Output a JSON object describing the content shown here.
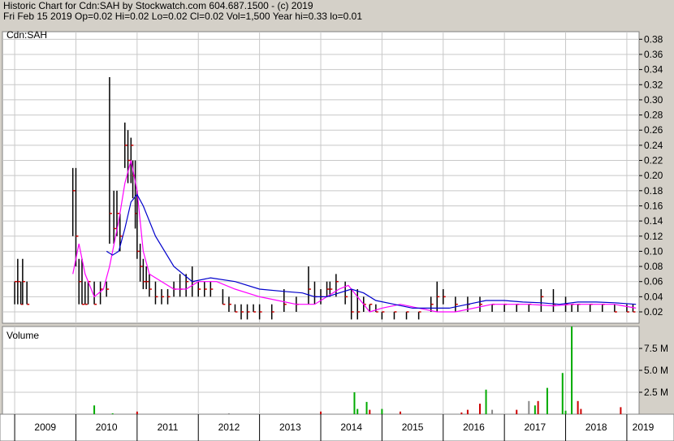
{
  "header": {
    "title": "Historic Chart for Cdn:SAH by Stockwatch.com 604.687.1500 - (c) 2019",
    "quote": "Fri Feb 15 2019   Op=0.02  Hi=0.02  Lo=0.02  Cl=0.02  Vol=1,500  Year hi=0.33  lo=0.01"
  },
  "chart_data": [
    {
      "type": "line",
      "title": "Cdn:SAH",
      "xlabel": "",
      "ylabel": "",
      "ylim": [
        0.005,
        0.39
      ],
      "grid": true,
      "legend": "none",
      "yticks": [
        "0.02",
        "0.04",
        "0.06",
        "0.08",
        "0.10",
        "0.12",
        "0.14",
        "0.16",
        "0.18",
        "0.20",
        "0.22",
        "0.24",
        "0.26",
        "0.28",
        "0.30",
        "0.32",
        "0.34",
        "0.36",
        "0.38"
      ],
      "xticks": [
        "2009",
        "2010",
        "2011",
        "2012",
        "2013",
        "2014",
        "2015",
        "2016",
        "2017",
        "2018",
        "2019"
      ],
      "series": [
        {
          "kind": "price-bars",
          "color": "#000000",
          "close_color": "#cc0000",
          "x": [
            2009.0,
            2009.05,
            2009.1,
            2009.13,
            2009.2,
            2009.95,
            2010.0,
            2010.05,
            2010.1,
            2010.15,
            2010.2,
            2010.3,
            2010.4,
            2010.5,
            2010.55,
            2010.62,
            2010.67,
            2010.72,
            2010.8,
            2010.85,
            2010.9,
            2010.93,
            2010.97,
            2011.0,
            2011.05,
            2011.1,
            2011.15,
            2011.2,
            2011.3,
            2011.4,
            2011.5,
            2011.6,
            2011.7,
            2011.8,
            2011.9,
            2012.0,
            2012.1,
            2012.2,
            2012.4,
            2012.5,
            2012.6,
            2012.7,
            2012.8,
            2012.9,
            2013.0,
            2013.2,
            2013.4,
            2013.6,
            2013.8,
            2013.9,
            2014.0,
            2014.1,
            2014.15,
            2014.25,
            2014.4,
            2014.5,
            2014.6,
            2014.7,
            2014.8,
            2014.9,
            2015.0,
            2015.2,
            2015.4,
            2015.6,
            2015.8,
            2015.9,
            2016.0,
            2016.2,
            2016.4,
            2016.6,
            2016.8,
            2017.0,
            2017.2,
            2017.4,
            2017.6,
            2017.8,
            2018.0,
            2018.1,
            2018.2,
            2018.4,
            2018.6,
            2018.8,
            2019.0,
            2019.1
          ],
          "high": [
            0.06,
            0.09,
            0.06,
            0.09,
            0.06,
            0.21,
            0.21,
            0.09,
            0.09,
            0.06,
            0.06,
            0.06,
            0.06,
            0.06,
            0.33,
            0.18,
            0.18,
            0.15,
            0.27,
            0.26,
            0.25,
            0.22,
            0.22,
            0.18,
            0.11,
            0.09,
            0.08,
            0.07,
            0.06,
            0.05,
            0.05,
            0.06,
            0.07,
            0.07,
            0.08,
            0.06,
            0.06,
            0.06,
            0.05,
            0.04,
            0.03,
            0.03,
            0.03,
            0.03,
            0.03,
            0.03,
            0.05,
            0.04,
            0.08,
            0.06,
            0.05,
            0.06,
            0.06,
            0.07,
            0.06,
            0.05,
            0.05,
            0.04,
            0.03,
            0.03,
            0.02,
            0.02,
            0.02,
            0.02,
            0.04,
            0.06,
            0.05,
            0.04,
            0.04,
            0.04,
            0.03,
            0.03,
            0.03,
            0.03,
            0.05,
            0.05,
            0.04,
            0.03,
            0.03,
            0.03,
            0.03,
            0.03,
            0.03,
            0.03
          ],
          "low": [
            0.03,
            0.03,
            0.03,
            0.03,
            0.03,
            0.12,
            0.08,
            0.03,
            0.03,
            0.03,
            0.03,
            0.03,
            0.03,
            0.04,
            0.11,
            0.11,
            0.12,
            0.1,
            0.21,
            0.19,
            0.19,
            0.17,
            0.13,
            0.09,
            0.06,
            0.05,
            0.05,
            0.04,
            0.03,
            0.03,
            0.03,
            0.04,
            0.04,
            0.04,
            0.04,
            0.04,
            0.04,
            0.04,
            0.03,
            0.02,
            0.02,
            0.01,
            0.01,
            0.02,
            0.01,
            0.01,
            0.02,
            0.02,
            0.03,
            0.03,
            0.03,
            0.04,
            0.04,
            0.04,
            0.03,
            0.01,
            0.01,
            0.02,
            0.02,
            0.02,
            0.01,
            0.01,
            0.01,
            0.01,
            0.02,
            0.02,
            0.03,
            0.02,
            0.02,
            0.02,
            0.02,
            0.02,
            0.02,
            0.02,
            0.02,
            0.02,
            0.02,
            0.02,
            0.02,
            0.02,
            0.02,
            0.02,
            0.02,
            0.02
          ],
          "close": [
            0.06,
            0.06,
            0.03,
            0.06,
            0.03,
            0.18,
            0.12,
            0.06,
            0.03,
            0.03,
            0.06,
            0.03,
            0.05,
            0.05,
            0.15,
            0.13,
            0.15,
            0.12,
            0.24,
            0.22,
            0.24,
            0.2,
            0.15,
            0.1,
            0.08,
            0.06,
            0.06,
            0.05,
            0.04,
            0.04,
            0.04,
            0.05,
            0.05,
            0.06,
            0.06,
            0.05,
            0.05,
            0.05,
            0.03,
            0.03,
            0.02,
            0.02,
            0.02,
            0.02,
            0.02,
            0.02,
            0.03,
            0.03,
            0.05,
            0.04,
            0.04,
            0.05,
            0.05,
            0.06,
            0.04,
            0.02,
            0.02,
            0.03,
            0.03,
            0.02,
            0.02,
            0.02,
            0.02,
            0.02,
            0.03,
            0.04,
            0.04,
            0.03,
            0.03,
            0.03,
            0.03,
            0.03,
            0.03,
            0.03,
            0.04,
            0.03,
            0.03,
            0.03,
            0.03,
            0.03,
            0.03,
            0.02,
            0.02,
            0.02
          ]
        },
        {
          "kind": "moving-average",
          "color": "#ff00ff",
          "x": [
            2009.95,
            2010.05,
            2010.15,
            2010.3,
            2010.45,
            2010.55,
            2010.7,
            2010.8,
            2010.9,
            2011.0,
            2011.1,
            2011.2,
            2011.4,
            2011.6,
            2011.8,
            2012.0,
            2012.3,
            2012.6,
            2013.0,
            2013.3,
            2013.6,
            2013.9,
            2014.1,
            2014.3,
            2014.45,
            2014.6,
            2014.8,
            2015.0,
            2015.3,
            2015.6,
            2015.9,
            2016.2,
            2016.5,
            2016.8,
            2017.1,
            2017.4,
            2017.8,
            2018.1,
            2018.4,
            2018.8,
            2019.15
          ],
          "values": [
            0.07,
            0.11,
            0.07,
            0.04,
            0.05,
            0.08,
            0.14,
            0.19,
            0.22,
            0.18,
            0.1,
            0.07,
            0.06,
            0.05,
            0.05,
            0.06,
            0.06,
            0.05,
            0.04,
            0.035,
            0.03,
            0.03,
            0.04,
            0.05,
            0.055,
            0.04,
            0.02,
            0.025,
            0.03,
            0.025,
            0.02,
            0.02,
            0.025,
            0.03,
            0.03,
            0.03,
            0.028,
            0.03,
            0.03,
            0.03,
            0.025
          ]
        },
        {
          "kind": "moving-average",
          "color": "#0000cc",
          "x": [
            2010.5,
            2010.6,
            2010.7,
            2010.8,
            2010.9,
            2011.0,
            2011.1,
            2011.3,
            2011.6,
            2011.9,
            2012.2,
            2012.6,
            2013.0,
            2013.4,
            2013.7,
            2013.9,
            2014.1,
            2014.3,
            2014.5,
            2014.7,
            2014.9,
            2015.2,
            2015.5,
            2015.8,
            2016.1,
            2016.4,
            2016.7,
            2017.0,
            2017.3,
            2017.6,
            2017.9,
            2018.2,
            2018.5,
            2018.8,
            2019.15
          ],
          "values": [
            0.1,
            0.095,
            0.1,
            0.13,
            0.165,
            0.175,
            0.16,
            0.12,
            0.08,
            0.06,
            0.065,
            0.06,
            0.05,
            0.047,
            0.045,
            0.04,
            0.04,
            0.045,
            0.05,
            0.045,
            0.035,
            0.03,
            0.025,
            0.025,
            0.025,
            0.03,
            0.035,
            0.035,
            0.033,
            0.032,
            0.03,
            0.033,
            0.033,
            0.032,
            0.03
          ]
        }
      ]
    },
    {
      "type": "bar",
      "title": "Volume",
      "xlabel": "",
      "ylabel": "",
      "ylim": [
        0,
        10000000
      ],
      "grid": true,
      "yticks": [
        "2.5 M",
        "5.0 M",
        "7.5 M"
      ],
      "up_color": "#00aa00",
      "down_color": "#cc0000",
      "flat_color": "#888888",
      "x": [
        2010.3,
        2010.6,
        2011.0,
        2012.5,
        2014.0,
        2014.55,
        2014.6,
        2014.75,
        2014.8,
        2015.0,
        2015.3,
        2016.3,
        2016.4,
        2016.6,
        2016.7,
        2016.8,
        2017.2,
        2017.4,
        2017.5,
        2017.55,
        2017.7,
        2017.95,
        2018.0,
        2018.1,
        2018.2,
        2018.25,
        2018.9
      ],
      "values": [
        1000000,
        100000,
        300000,
        100000,
        300000,
        2500000,
        600000,
        1400000,
        500000,
        600000,
        300000,
        200000,
        500000,
        1200000,
        2800000,
        500000,
        500000,
        1500000,
        1000000,
        1500000,
        3000000,
        4700000,
        400000,
        10000000,
        1500000,
        600000,
        800000
      ],
      "colors": [
        "up",
        "up",
        "down",
        "flat",
        "down",
        "up",
        "up",
        "up",
        "down",
        "up",
        "down",
        "down",
        "down",
        "down",
        "up",
        "flat",
        "down",
        "flat",
        "up",
        "down",
        "up",
        "up",
        "up",
        "up",
        "down",
        "down",
        "down"
      ]
    }
  ]
}
